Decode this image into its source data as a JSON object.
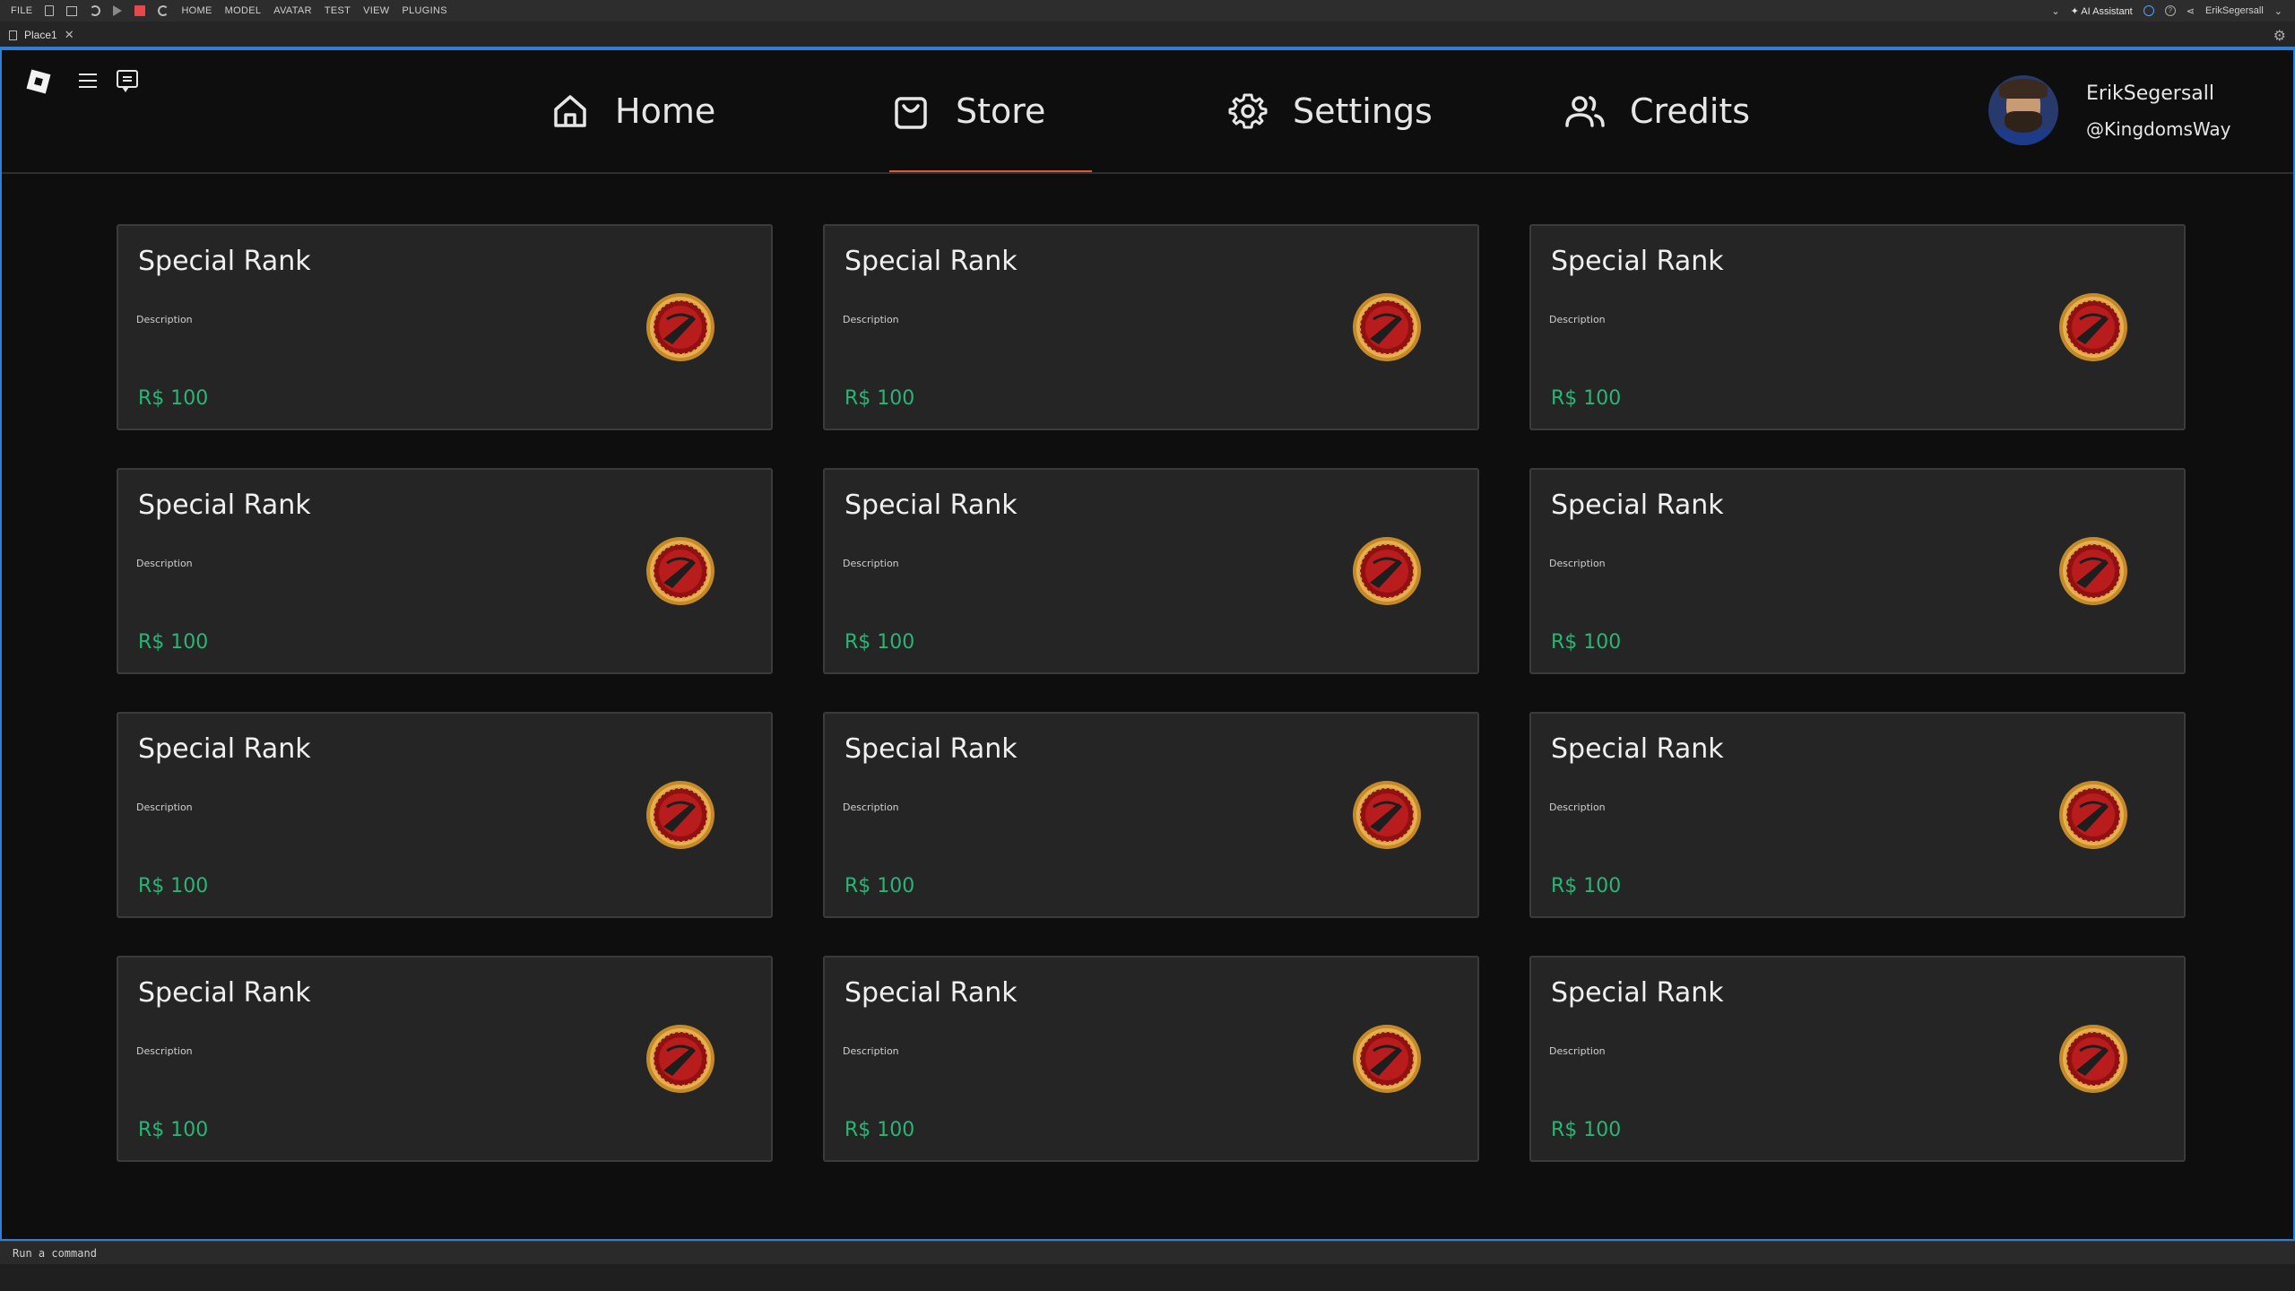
{
  "studio": {
    "menus": [
      "FILE",
      "HOME",
      "MODEL",
      "AVATAR",
      "TEST",
      "VIEW",
      "PLUGINS"
    ],
    "ai_assistant": "AI Assistant",
    "account": "ErikSegersall",
    "tab_title": "Place1",
    "command_placeholder": "Run a command"
  },
  "nav": {
    "home": "Home",
    "store": "Store",
    "settings": "Settings",
    "credits": "Credits",
    "active": "store",
    "accent": "#e05a2c"
  },
  "profile": {
    "name": "ErikSegersall",
    "handle": "@KingdomsWay"
  },
  "store": {
    "price_color": "#2ab574",
    "items": [
      {
        "title": "Special Rank",
        "description": "Description",
        "price": "R$ 100"
      },
      {
        "title": "Special Rank",
        "description": "Description",
        "price": "R$ 100"
      },
      {
        "title": "Special Rank",
        "description": "Description",
        "price": "R$ 100"
      },
      {
        "title": "Special Rank",
        "description": "Description",
        "price": "R$ 100"
      },
      {
        "title": "Special Rank",
        "description": "Description",
        "price": "R$ 100"
      },
      {
        "title": "Special Rank",
        "description": "Description",
        "price": "R$ 100"
      },
      {
        "title": "Special Rank",
        "description": "Description",
        "price": "R$ 100"
      },
      {
        "title": "Special Rank",
        "description": "Description",
        "price": "R$ 100"
      },
      {
        "title": "Special Rank",
        "description": "Description",
        "price": "R$ 100"
      },
      {
        "title": "Special Rank",
        "description": "Description",
        "price": "R$ 100"
      },
      {
        "title": "Special Rank",
        "description": "Description",
        "price": "R$ 100"
      },
      {
        "title": "Special Rank",
        "description": "Description",
        "price": "R$ 100"
      }
    ]
  }
}
